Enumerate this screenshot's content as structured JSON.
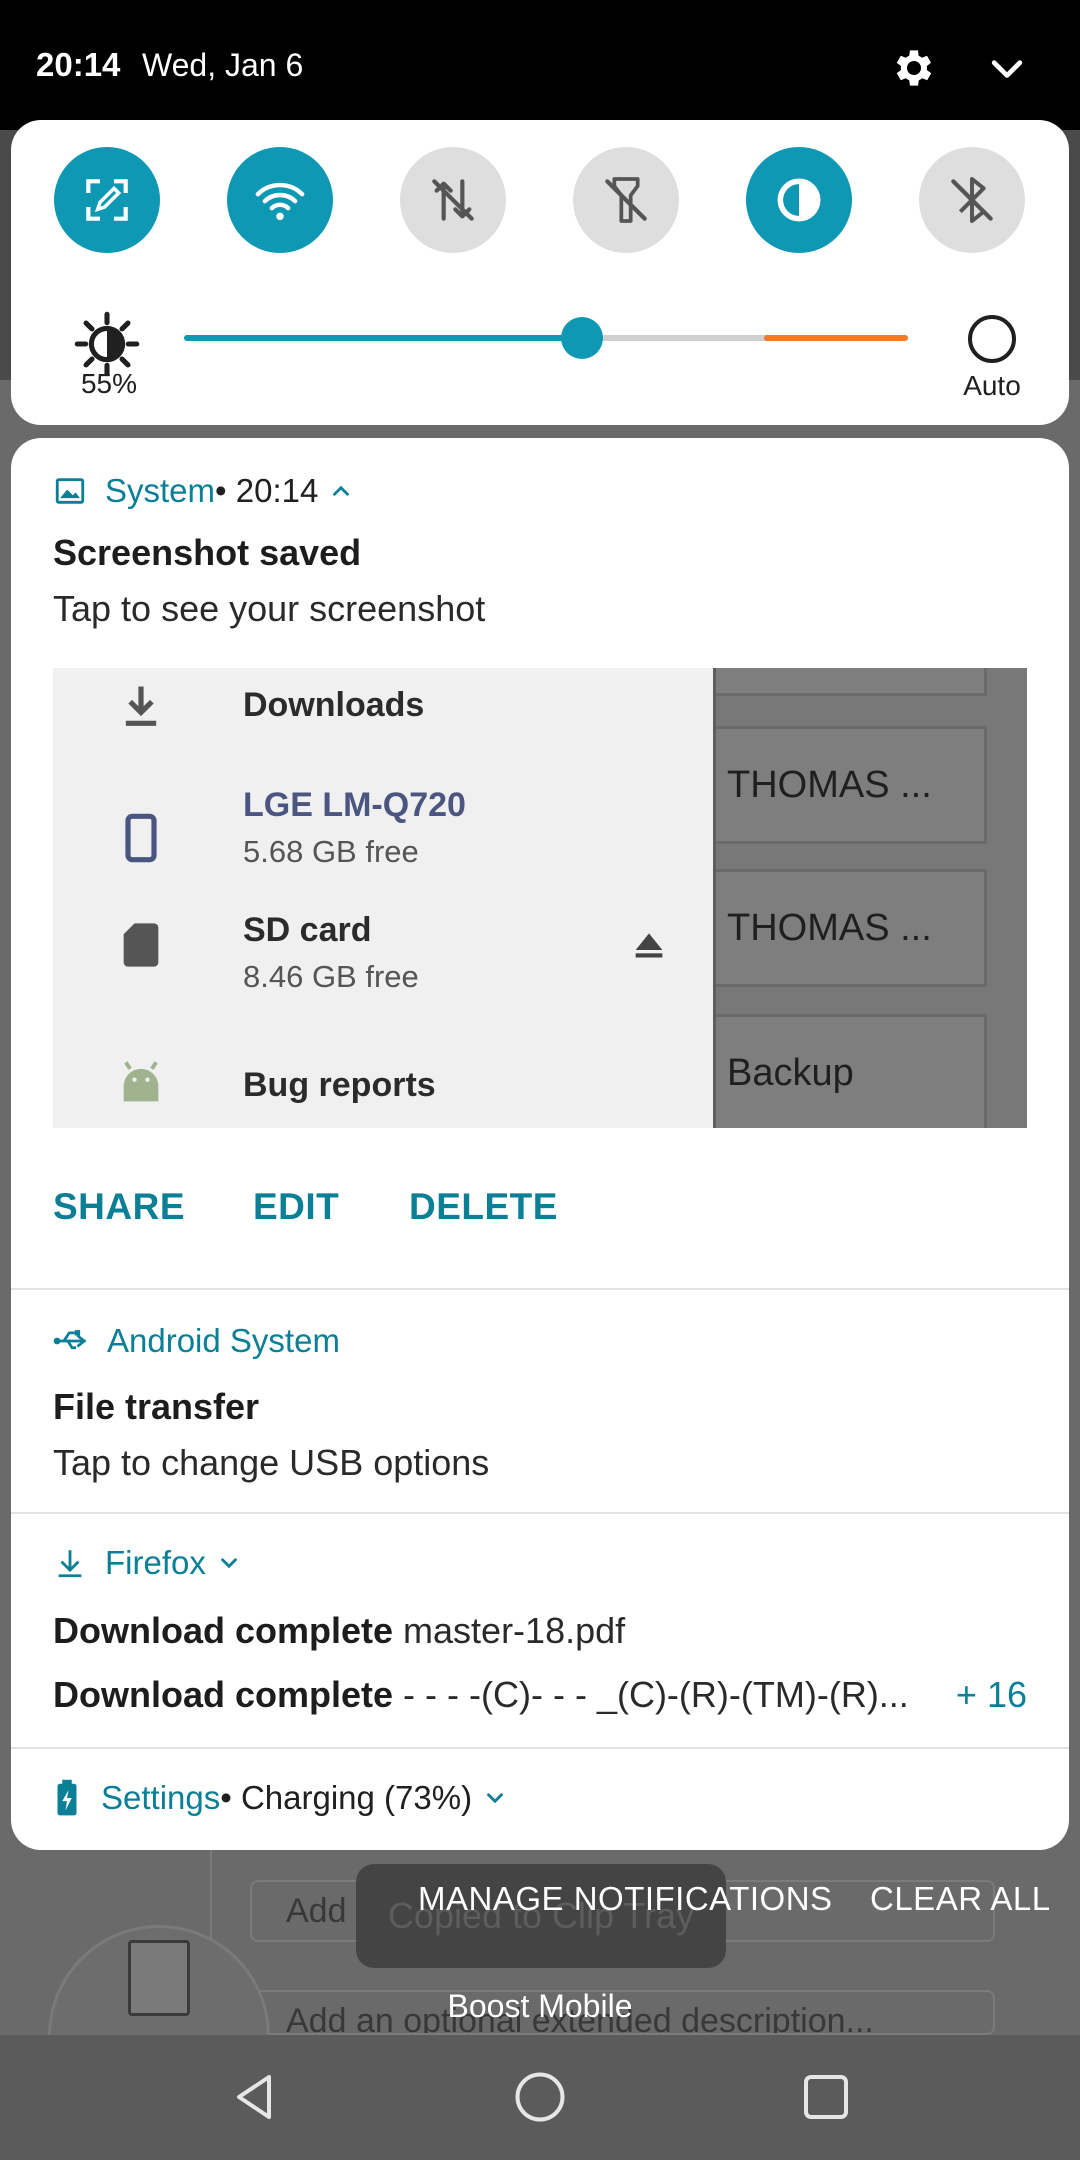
{
  "status_bar": {
    "time": "20:14",
    "date": "Wed, Jan 6"
  },
  "quick_settings": {
    "tiles": [
      {
        "name": "screen-capture",
        "state": "on"
      },
      {
        "name": "wifi",
        "state": "on"
      },
      {
        "name": "mobile-data",
        "state": "off"
      },
      {
        "name": "flashlight",
        "state": "off"
      },
      {
        "name": "data-saver",
        "state": "on"
      },
      {
        "name": "bluetooth",
        "state": "off"
      }
    ],
    "brightness": {
      "value_label": "55%",
      "value": 0.55,
      "auto_label": "Auto"
    }
  },
  "notifications": {
    "system": {
      "app": "System",
      "meta": " • 20:14",
      "title": "Screenshot saved",
      "text": "Tap to see your screenshot",
      "preview": {
        "items": [
          {
            "title": "Downloads",
            "subtitle": "",
            "icon": "download-icon"
          },
          {
            "title": "LGE LM-Q720",
            "subtitle": "5.68 GB free",
            "icon": "phone-icon"
          },
          {
            "title": "SD card",
            "subtitle": "8.46 GB free",
            "icon": "sd-card-icon"
          },
          {
            "title": "Bug reports",
            "subtitle": "",
            "icon": "android-icon"
          }
        ],
        "cards": [
          "THOMAS ...",
          "THOMAS ...",
          "Backup"
        ]
      },
      "actions": {
        "share": "SHARE",
        "edit": "EDIT",
        "delete": "DELETE"
      }
    },
    "android_system": {
      "app": "Android System",
      "title": "File transfer",
      "text": "Tap to change USB options"
    },
    "firefox": {
      "app": "Firefox",
      "line1_bold": "Download complete",
      "line1_text": " master-18.pdf",
      "line2_bold": "Download complete",
      "line2_text": " - - - -(C)- - - _(C)-(R)-(TM)-(R)...",
      "more_count": "+ 16"
    },
    "settings": {
      "app": "Settings",
      "meta": " • Charging (73%)"
    }
  },
  "footer": {
    "manage": "MANAGE NOTIFICATIONS",
    "clear": "CLEAR ALL",
    "carrier": "Boost Mobile",
    "toast": "Copied to Clip Tray",
    "bg_field": "Add file...",
    "bg_field2": "Add an optional extended description..."
  },
  "colors": {
    "accent": "#0e98b3",
    "accent_text": "#0a7f96",
    "warning": "#ee7c2a"
  }
}
